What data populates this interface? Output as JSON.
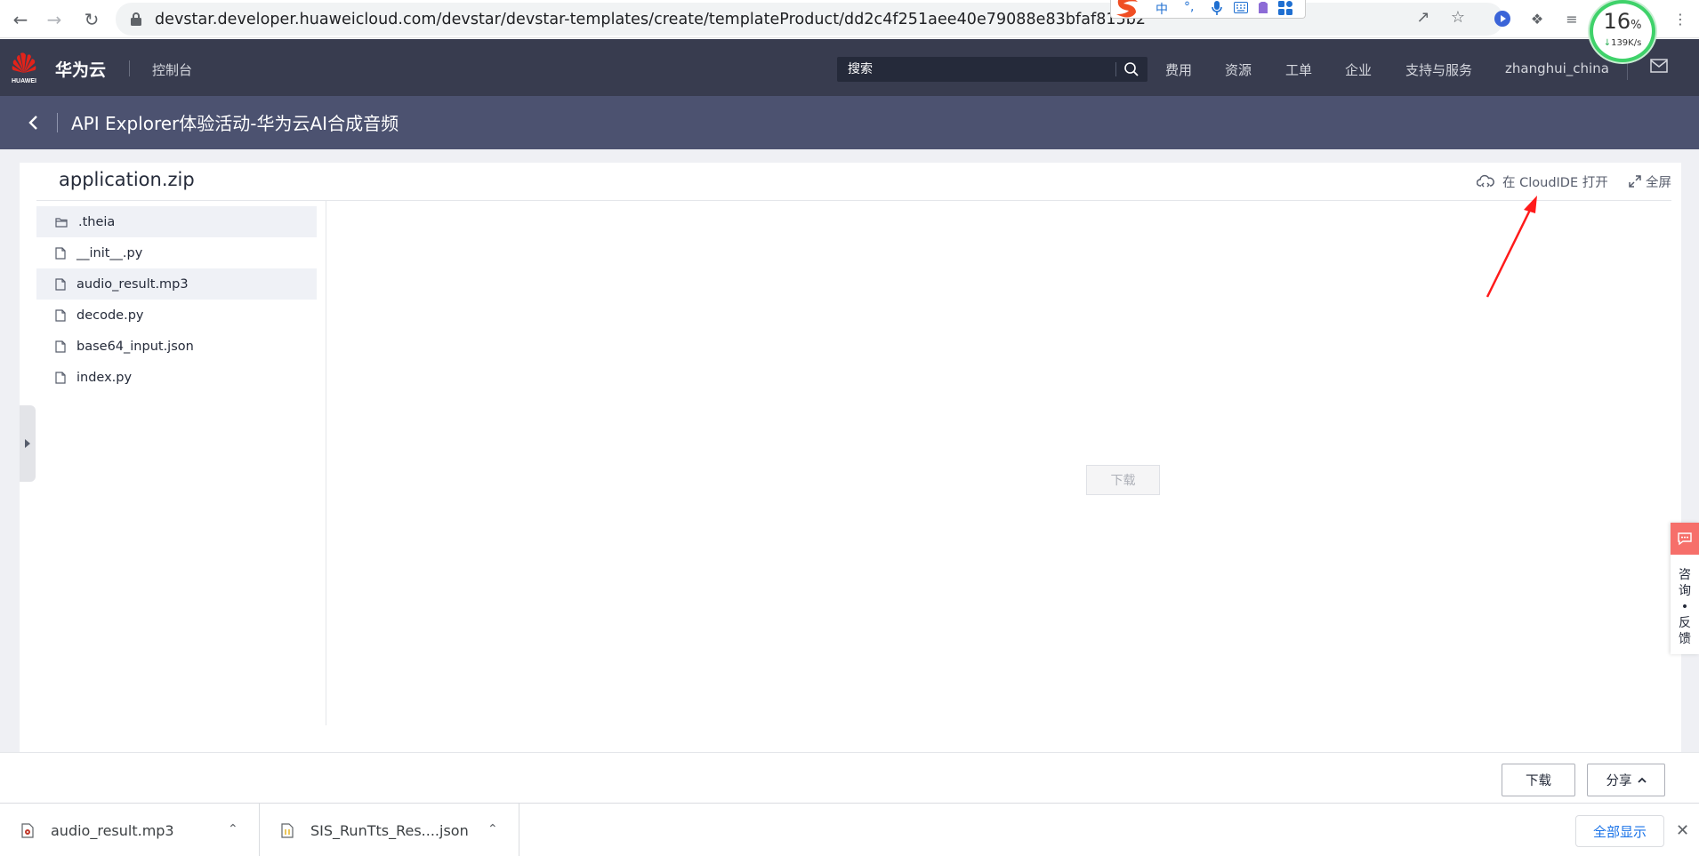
{
  "browser": {
    "url": "devstar.developer.huaweicloud.com/devstar/devstar-templates/create/templateProduct/dd2c4f251aee40e79088e83bfaf815b2",
    "ime": {
      "lang": "中",
      "punct": "°,"
    },
    "speed_meter": {
      "percent": "16",
      "unit": "%",
      "rate": "139K/s"
    }
  },
  "header": {
    "brand": "华为云",
    "logo_text": "HUAWEI",
    "console": "控制台",
    "search_placeholder": "搜索",
    "links": [
      "费用",
      "资源",
      "工单",
      "企业",
      "支持与服务"
    ],
    "user": "zhanghui_china"
  },
  "title_bar": {
    "title": "API Explorer体验活动-华为云AI合成音频"
  },
  "panel": {
    "archive_name": "application.zip",
    "open_in_ide": "在 CloudIDE 打开",
    "fullscreen": "全屏",
    "center_download": "下载"
  },
  "files": [
    {
      "name": ".theia",
      "type": "folder",
      "selected": true
    },
    {
      "name": "__init__.py",
      "type": "file",
      "selected": false
    },
    {
      "name": "audio_result.mp3",
      "type": "file",
      "selected": true
    },
    {
      "name": "decode.py",
      "type": "file",
      "selected": false
    },
    {
      "name": "base64_input.json",
      "type": "file",
      "selected": false
    },
    {
      "name": "index.py",
      "type": "file",
      "selected": false
    }
  ],
  "feedback": {
    "label_chars": [
      "咨",
      "询",
      "•",
      "反",
      "馈"
    ]
  },
  "actions": {
    "download": "下载",
    "share": "分享"
  },
  "download_shelf": {
    "items": [
      {
        "name": "audio_result.mp3",
        "icon": "audio-file-icon"
      },
      {
        "name": "SIS_RunTts_Res....json",
        "icon": "json-file-icon"
      }
    ],
    "show_all": "全部显示"
  },
  "colors": {
    "header_bg": "#383c4f",
    "title_bar_bg": "#4c5270",
    "feedback_accent": "#f66f6a",
    "link_blue": "#1a73e8",
    "arrow_red": "#ff1a1a"
  }
}
